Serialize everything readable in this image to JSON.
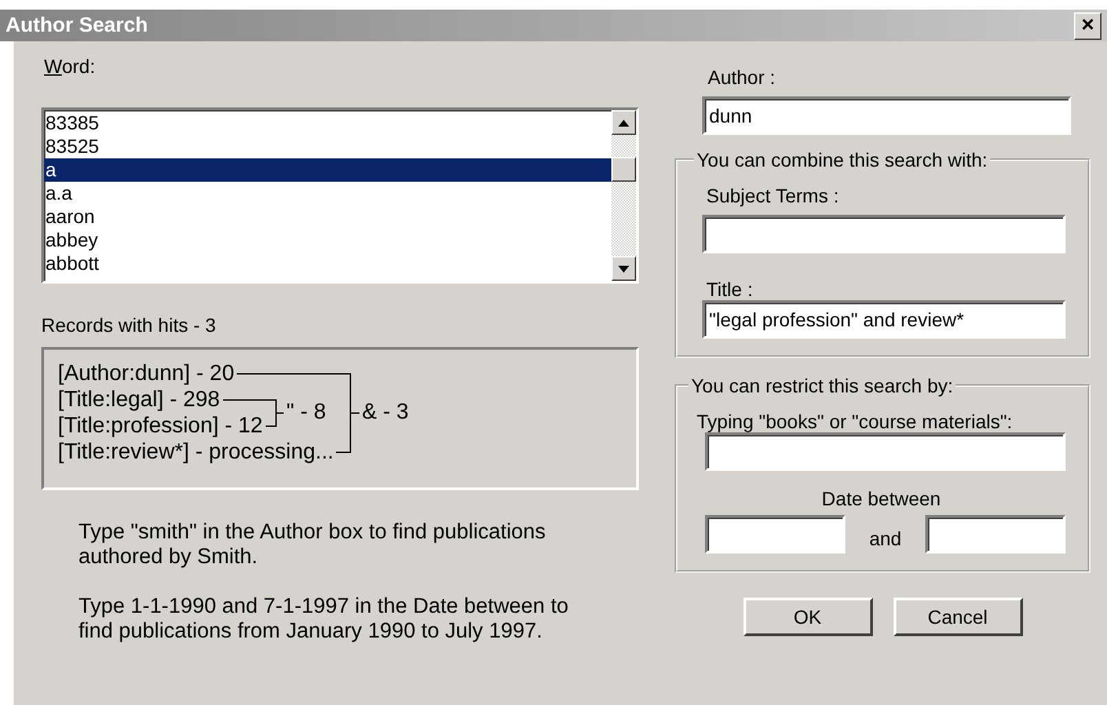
{
  "window": {
    "title": "Author Search",
    "close": "×"
  },
  "word": {
    "label": "Word:",
    "items": [
      {
        "text": "83385",
        "selected": false
      },
      {
        "text": "83525",
        "selected": false
      },
      {
        "text": "a",
        "selected": true
      },
      {
        "text": "a.a",
        "selected": false
      },
      {
        "text": "aaron",
        "selected": false
      },
      {
        "text": "abbey",
        "selected": false
      },
      {
        "text": "abbott",
        "selected": false
      }
    ]
  },
  "records": {
    "label": "Records with hits - 3",
    "lines": [
      "[Author:dunn] - 20",
      "[Title:legal] - 298",
      "[Title:profession] - 12",
      "[Title:review*] - processing..."
    ],
    "phrase_result": "\" - 8",
    "and_result": "& - 3"
  },
  "hints": [
    "Type \"smith\" in the Author box to find publications authored by Smith.",
    "Type 1-1-1990 and 7-1-1997 in the Date between to find publications from January 1990 to July 1997."
  ],
  "author": {
    "label": "Author :",
    "value": "dunn"
  },
  "combine": {
    "legend": "You can combine this search with:",
    "subject": {
      "label": "Subject Terms :"
    },
    "title": {
      "label": "Title :",
      "value": "\"legal profession\" and review*"
    }
  },
  "restrict": {
    "legend": "You can restrict this search by:",
    "type": {
      "label": "Typing \"books\" or \"course materials\":"
    },
    "date_label": "Date between",
    "date_and": "and"
  },
  "buttons": [
    "OK",
    "Cancel"
  ]
}
